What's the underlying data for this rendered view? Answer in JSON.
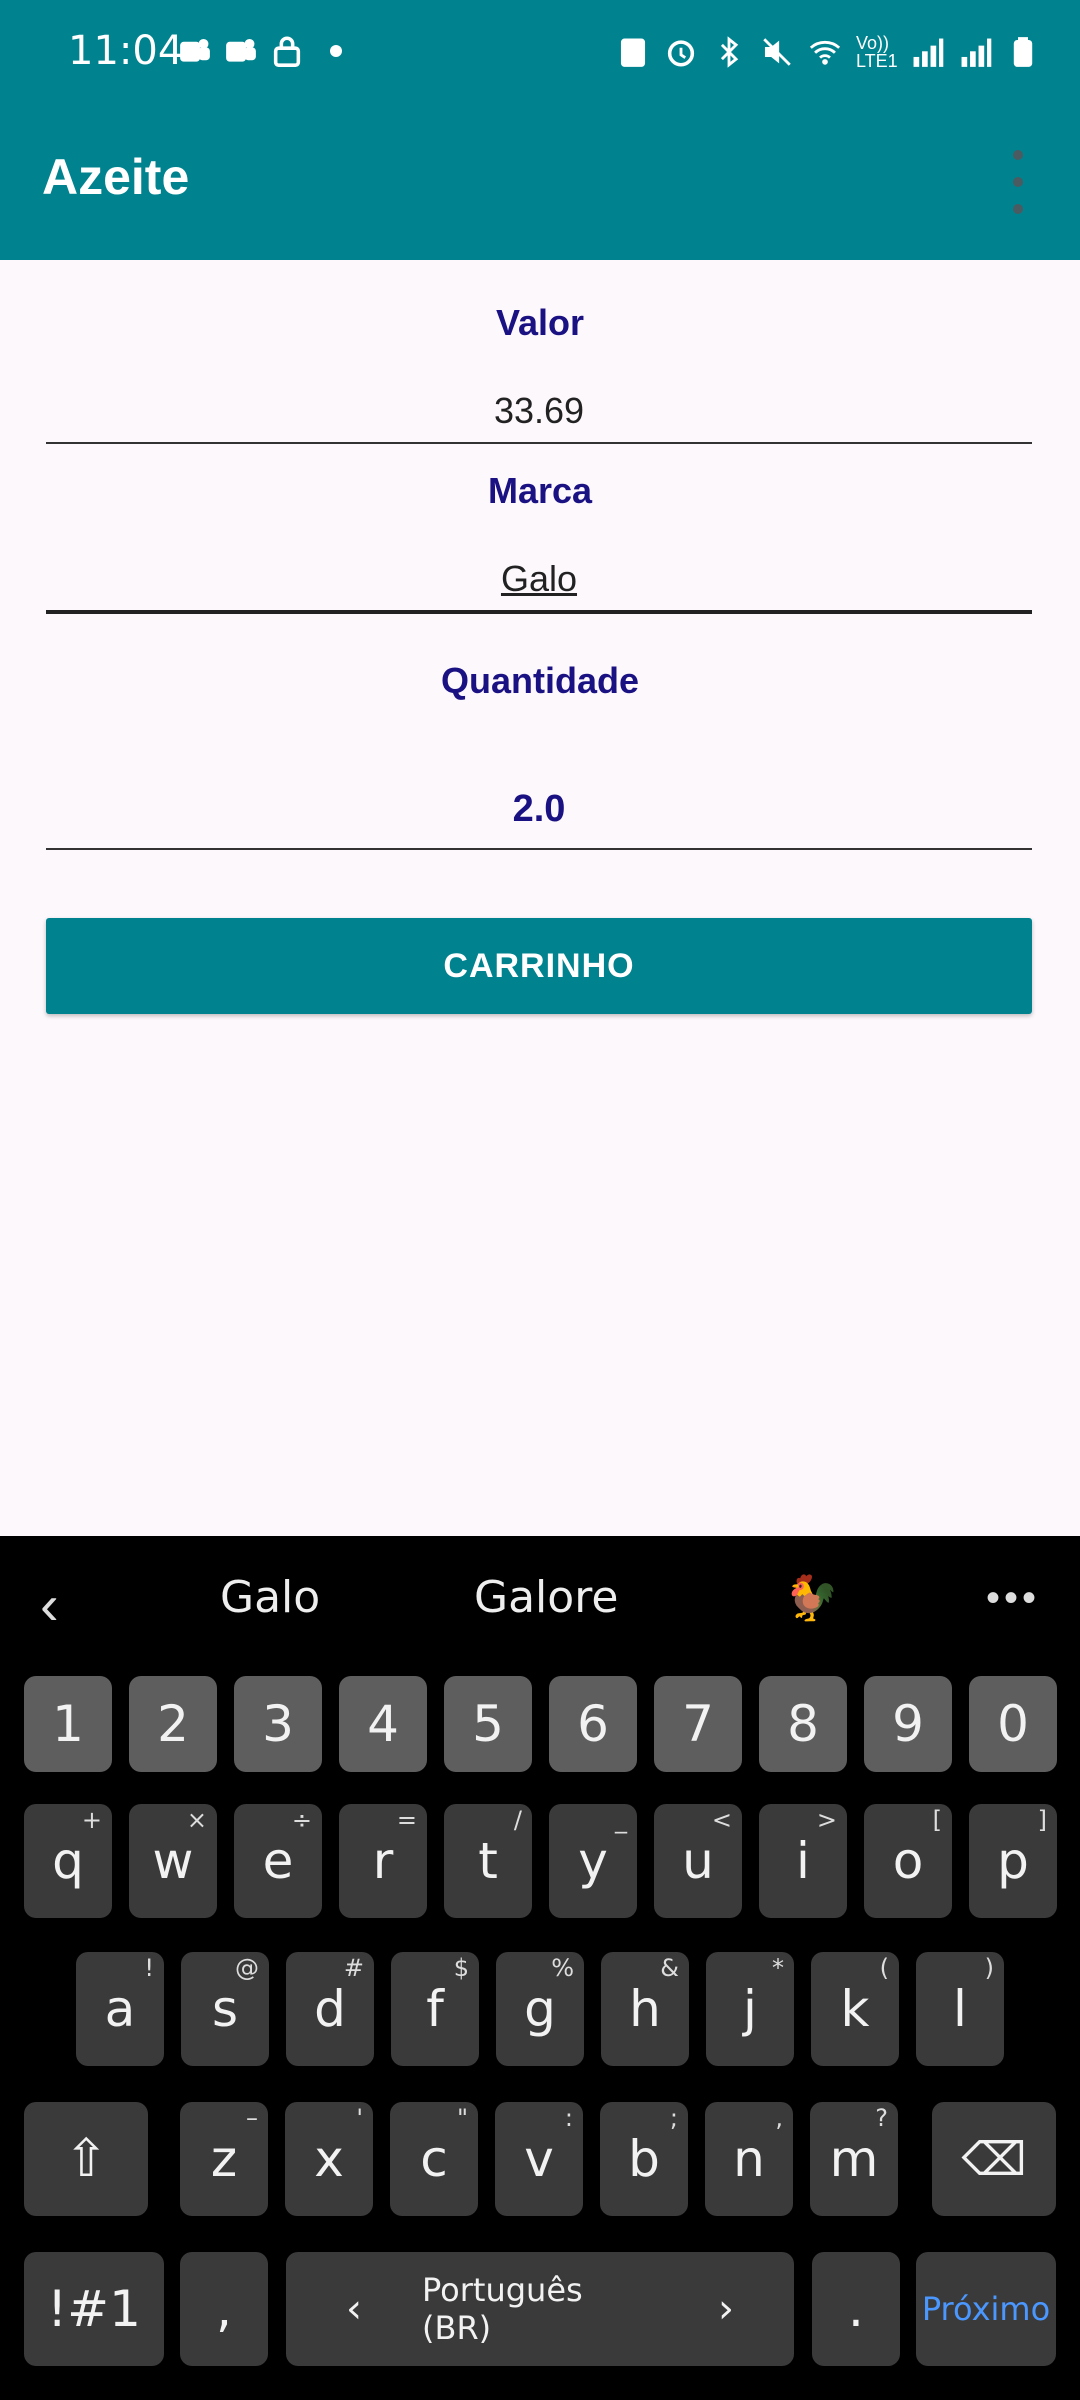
{
  "status_bar": {
    "time": "11:04",
    "left_icons": [
      "teams-icon",
      "teams-icon",
      "lock-icon",
      "dot-icon"
    ],
    "right_icons": [
      "building-icon",
      "alarm-icon",
      "bluetooth-icon",
      "mute-icon",
      "wifi-icon",
      "signal-icon",
      "signal-icon",
      "battery-icon"
    ],
    "network_label": "Vo)) LTE1"
  },
  "app_bar": {
    "title": "Azeite"
  },
  "form": {
    "valor_label": "Valor",
    "valor_value": "33.69",
    "marca_label": "Marca",
    "marca_value": "Galo",
    "quantidade_label": "Quantidade",
    "quantidade_value": "2.0"
  },
  "button": {
    "label": "CARRINHO"
  },
  "colors": {
    "primary": "#00838f",
    "label": "#1a1182",
    "background": "#fdf8fc"
  },
  "keyboard": {
    "suggestions": [
      "Galo",
      "Galore",
      "🐓"
    ],
    "row_numbers": [
      "1",
      "2",
      "3",
      "4",
      "5",
      "6",
      "7",
      "8",
      "9",
      "0"
    ],
    "row1": [
      {
        "k": "q",
        "h": "+"
      },
      {
        "k": "w",
        "h": "×"
      },
      {
        "k": "e",
        "h": "÷"
      },
      {
        "k": "r",
        "h": "="
      },
      {
        "k": "t",
        "h": "/"
      },
      {
        "k": "y",
        "h": "_"
      },
      {
        "k": "u",
        "h": "<"
      },
      {
        "k": "i",
        "h": ">"
      },
      {
        "k": "o",
        "h": "["
      },
      {
        "k": "p",
        "h": "]"
      }
    ],
    "row2": [
      {
        "k": "a",
        "h": "!"
      },
      {
        "k": "s",
        "h": "@"
      },
      {
        "k": "d",
        "h": "#"
      },
      {
        "k": "f",
        "h": "$"
      },
      {
        "k": "g",
        "h": "%"
      },
      {
        "k": "h",
        "h": "&"
      },
      {
        "k": "j",
        "h": "*"
      },
      {
        "k": "k",
        "h": "("
      },
      {
        "k": "l",
        "h": ")"
      }
    ],
    "row3": [
      {
        "k": "z",
        "h": "–"
      },
      {
        "k": "x",
        "h": "'"
      },
      {
        "k": "c",
        "h": "\""
      },
      {
        "k": "v",
        "h": ":"
      },
      {
        "k": "b",
        "h": ";"
      },
      {
        "k": "n",
        "h": ","
      },
      {
        "k": "m",
        "h": "?"
      }
    ],
    "symbols_label": "!#1",
    "comma_label": ",",
    "space_label": "Português (BR)",
    "period_label": ".",
    "next_label": "Próximo"
  }
}
